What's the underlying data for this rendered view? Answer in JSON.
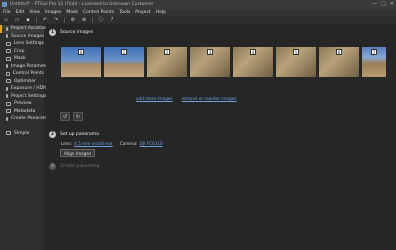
{
  "window": {
    "title": "Untitled* - PTGui Pro 11 (Trial) - Licensed to Unknown Customer",
    "controls": [
      "—",
      "□",
      "✕"
    ]
  },
  "menu": [
    "File",
    "Edit",
    "View",
    "Images",
    "Mask",
    "Control Points",
    "Tools",
    "Project",
    "Help"
  ],
  "toolbar": {
    "icons": [
      "new-icon",
      "open-icon",
      "save-icon",
      "undo-icon",
      "redo-icon",
      "settings-icon",
      "zoom-icon",
      "info-icon",
      "help-icon"
    ]
  },
  "sidebar": {
    "items": [
      {
        "label": "Project Assistant",
        "active": true
      },
      {
        "label": "Source Images"
      },
      {
        "label": "Lens Settings"
      },
      {
        "label": "Crop"
      },
      {
        "label": "Mask"
      },
      {
        "label": "Image Parameters"
      },
      {
        "label": "Control Points"
      },
      {
        "label": "Optimizer"
      },
      {
        "label": "Exposure / HDR"
      },
      {
        "label": "Project Settings"
      },
      {
        "label": "Preview"
      },
      {
        "label": "Metadata"
      },
      {
        "label": "Create Panorama"
      }
    ],
    "footer_item": {
      "label": "Simple"
    }
  },
  "main": {
    "step1": {
      "num": "1",
      "label": "Source images"
    },
    "thumbnails": [
      {
        "num": "0",
        "style": "sky"
      },
      {
        "num": "1",
        "style": "sky"
      },
      {
        "num": "2",
        "style": "gnd"
      },
      {
        "num": "3",
        "style": "gnd"
      },
      {
        "num": "4",
        "style": "gnd"
      },
      {
        "num": "5",
        "style": "gnd"
      },
      {
        "num": "6",
        "style": "gnd"
      },
      {
        "num": "7",
        "style": "mix"
      }
    ],
    "add_more_link": "add more images",
    "remove_link": "remove or reorder images",
    "rotate_left": "↺",
    "rotate_right": "↻",
    "step2": {
      "num": "2",
      "label": "Set up panorama"
    },
    "lens_label": "Lens:",
    "lens_value": "4.5 mm rectilinear",
    "camera_label": "Camera:",
    "camera_value": "DJI FC6310",
    "align_button": "Align Images",
    "step3": {
      "num": "3",
      "label": "Create panorama"
    }
  }
}
